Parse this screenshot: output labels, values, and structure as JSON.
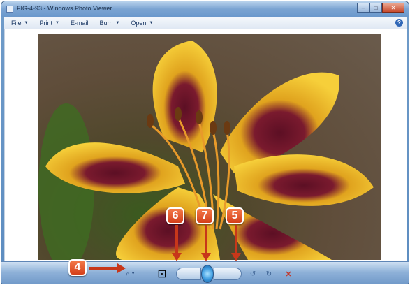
{
  "window": {
    "title": "FIG-4-93 - Windows Photo Viewer",
    "minimize": "–",
    "maximize": "□",
    "close": "✕"
  },
  "menu": {
    "items": [
      {
        "label": "File"
      },
      {
        "label": "Print"
      },
      {
        "label": "E-mail"
      },
      {
        "label": "Burn"
      },
      {
        "label": "Open"
      }
    ],
    "help": "?"
  },
  "toolbar": {
    "zoom_icon": "⌕",
    "actual_size_icon": "⊡",
    "rotate_ccw_icon": "↺",
    "rotate_cw_icon": "↻",
    "delete_icon": "✕"
  },
  "callouts": {
    "c4": "4",
    "c5": "5",
    "c6": "6",
    "c7": "7"
  },
  "colors": {
    "callout": "#e0542a",
    "arrow": "#c7371a",
    "toolbar": "#8eb1d8"
  }
}
